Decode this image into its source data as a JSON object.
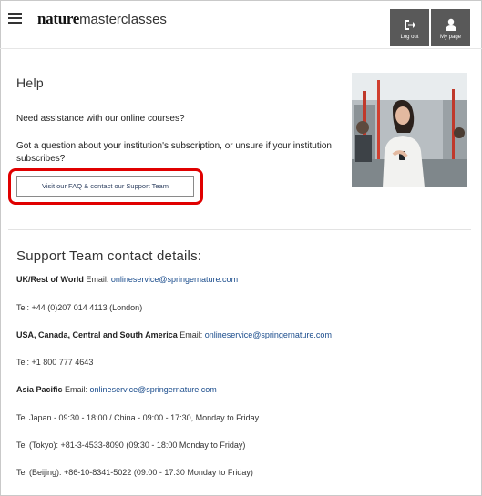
{
  "header": {
    "brand_bold": "nature",
    "brand_rest": "masterclasses",
    "logout_label": "Log out",
    "mypage_label": "My page"
  },
  "help": {
    "title": "Help",
    "line1": "Need assistance with our online courses?",
    "line2": "Got a question about your institution's subscription, or unsure if your institution subscribes?",
    "button_label": "Visit our FAQ & contact our Support Team"
  },
  "support": {
    "title": "Support Team contact details:",
    "rows": [
      {
        "region": "UK/Rest of World",
        "prefix": " Email: ",
        "email": "onlineservice@springernature.com"
      },
      {
        "text": "Tel: +44 (0)207 014 4113 (London)"
      },
      {
        "region": "USA, Canada, Central and South America",
        "prefix": " Email: ",
        "email": "onlineservice@springernature.com"
      },
      {
        "text": "Tel: +1 800 777 4643"
      },
      {
        "region": "Asia Pacific",
        "prefix": " Email: ",
        "email": "onlineservice@springernature.com"
      },
      {
        "text": "Tel Japan - 09:30 - 18:00 / China - 09:00 - 17:30, Monday to Friday"
      },
      {
        "text": "Tel (Tokyo): +81-3-4533-8090  (09:30 - 18:00 Monday to Friday)"
      },
      {
        "text": "Tel (Beijing): +86-10-8341-5022 (09:00 - 17:30 Monday to Friday)"
      }
    ]
  },
  "colors": {
    "highlight": "#e00000",
    "header_button": "#595959",
    "link": "#1a4c8c"
  },
  "icons": {
    "menu": "hamburger-icon",
    "logout": "logout-arrow-icon",
    "mypage": "person-icon"
  }
}
